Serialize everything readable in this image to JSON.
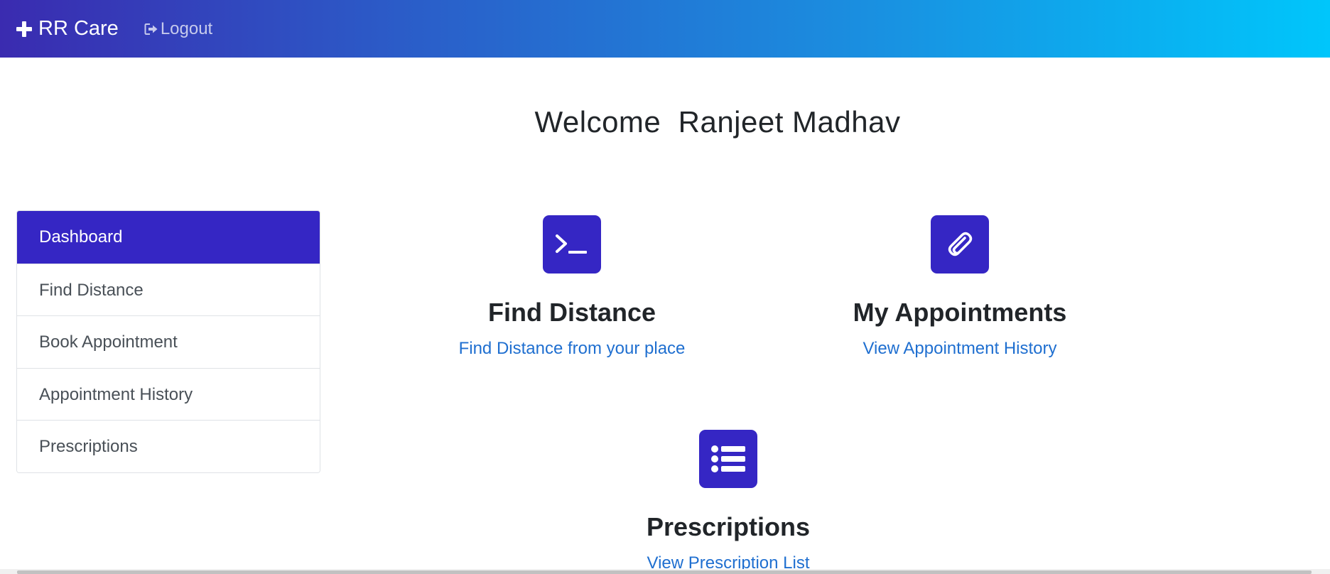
{
  "navbar": {
    "brand": "RR Care",
    "brand_icon": "plus-icon",
    "logout": "Logout",
    "logout_icon": "sign-out-icon",
    "gradient": [
      "#3a2bb0",
      "#00c6fb"
    ]
  },
  "welcome": {
    "prefix": "Welcome",
    "name": "Ranjeet Madhav"
  },
  "sidebar": {
    "items": [
      {
        "label": "Dashboard",
        "active": true
      },
      {
        "label": "Find Distance"
      },
      {
        "label": "Book Appointment"
      },
      {
        "label": "Appointment History"
      },
      {
        "label": "Prescriptions"
      }
    ]
  },
  "cards": [
    {
      "icon": "terminal-icon",
      "title": "Find Distance",
      "link": "Find Distance from your place"
    },
    {
      "icon": "paperclip-icon",
      "title": "My Appointments",
      "link": "View Appointment History"
    },
    {
      "icon": "list-icon",
      "title": "Prescriptions",
      "link": "View Prescription List"
    }
  ],
  "colors": {
    "accent": "#3526c4",
    "link": "#1f6fd0"
  }
}
